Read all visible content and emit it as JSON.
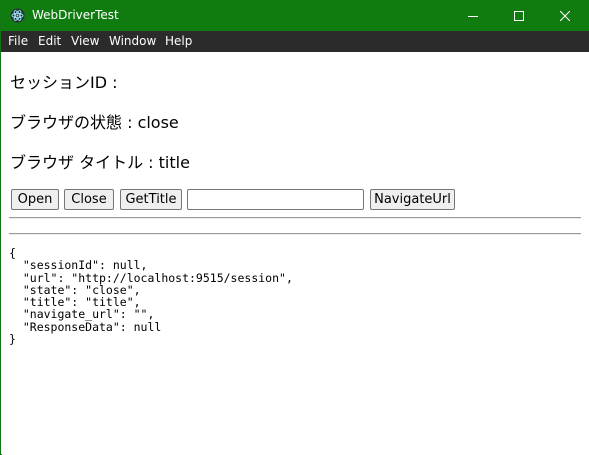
{
  "window": {
    "title": "WebDriverTest",
    "colors": {
      "titlebar": "#107c10",
      "menubar": "#2b2b2b"
    },
    "controls": [
      "minimize-icon",
      "maximize-icon",
      "close-icon"
    ]
  },
  "menu": {
    "file": "File",
    "edit": "Edit",
    "view": "View",
    "window": "Window",
    "help": "Help"
  },
  "main": {
    "session_line": "セッションID :",
    "state_line": "ブラウザの状態 : close",
    "title_line": "ブラウザ タイトル : title",
    "buttons": {
      "open": "Open",
      "close": "Close",
      "get_title": "GetTitle",
      "navigate": "NavigateUrl"
    },
    "url_input": {
      "value": "",
      "placeholder": ""
    },
    "json_output": "{\n  \"sessionId\": null,\n  \"url\": \"http://localhost:9515/session\",\n  \"state\": \"close\",\n  \"title\": \"title\",\n  \"navigate_url\": \"\",\n  \"ResponseData\": null\n}"
  }
}
